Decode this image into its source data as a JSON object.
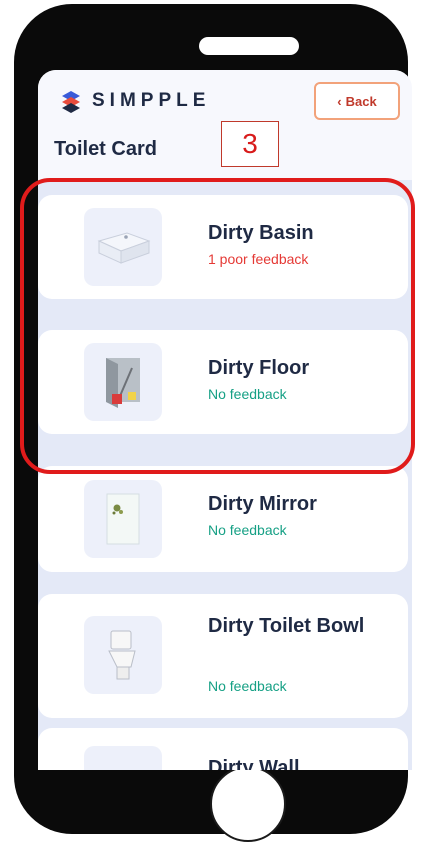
{
  "header": {
    "brand": "SIMPPLE",
    "back_label": "Back",
    "back_icon": "chevron-left-icon",
    "title": "Toilet Card"
  },
  "annotation": {
    "step_number": "3"
  },
  "items": [
    {
      "title": "Dirty Basin",
      "status": "1 poor feedback",
      "status_color": "#e53935",
      "icon": "basin-icon"
    },
    {
      "title": "Dirty Floor",
      "status": "No feedback",
      "status_color": "#16a085",
      "icon": "floor-icon"
    },
    {
      "title": "Dirty Mirror",
      "status": "No feedback",
      "status_color": "#16a085",
      "icon": "mirror-icon"
    },
    {
      "title": "Dirty Toilet Bowl",
      "status": "No feedback",
      "status_color": "#16a085",
      "icon": "toilet-bowl-icon"
    },
    {
      "title": "Dirty Wall",
      "status": "",
      "status_color": "#16a085",
      "icon": "wall-icon"
    }
  ],
  "colors": {
    "accent_red": "#e01b1b",
    "brand_navy": "#1f2a44",
    "list_background": "#e4e9f7",
    "back_border": "#f2a27a"
  }
}
